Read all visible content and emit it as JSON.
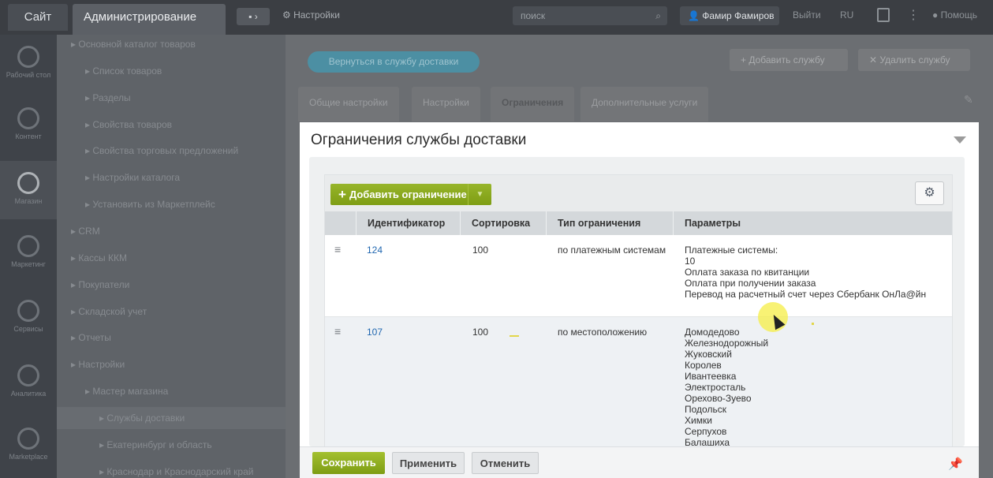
{
  "topbar": {
    "site_tab": "Сайт",
    "admin_tab": "Администрирование",
    "chat_label": "▪ ›",
    "settings_label": "Настройки",
    "search_placeholder": "поиск",
    "user_name": "Фамир Фамиров",
    "exit_label": "Выйти",
    "lang_label": "RU",
    "help_label": "Помощь"
  },
  "iconbar": {
    "items": [
      {
        "label": "Рабочий стол",
        "icon": "desktop-icon"
      },
      {
        "label": "Контент",
        "icon": "content-icon"
      },
      {
        "label": "Магазин",
        "icon": "basket-icon"
      },
      {
        "label": "Маркетинг",
        "icon": "marketing-icon"
      },
      {
        "label": "Сервисы",
        "icon": "services-icon"
      },
      {
        "label": "Аналитика",
        "icon": "analytics-icon"
      },
      {
        "label": "Marketplace",
        "icon": "cloud-icon"
      }
    ]
  },
  "tree": {
    "items": [
      {
        "label": "▸  Основной каталог товаров"
      },
      {
        "label": "▸  Список товаров"
      },
      {
        "label": "▸  Разделы"
      },
      {
        "label": "▸  Свойства товаров"
      },
      {
        "label": "▸  Свойства торговых предложений"
      },
      {
        "label": "▸  Настройки каталога"
      },
      {
        "label": "▸  Установить из Маркетплейс"
      },
      {
        "label": "▸  CRM"
      },
      {
        "label": "▸  Кассы ККМ"
      },
      {
        "label": "▸  Покупатели"
      },
      {
        "label": "▸  Складской учет"
      },
      {
        "label": "▸  Отчеты"
      },
      {
        "label": "▸  Настройки"
      },
      {
        "label": "▸  Мастер магазина"
      },
      {
        "label": "▸  Службы доставки"
      },
      {
        "label": "▸  Екатеринбург и область"
      },
      {
        "label": "▸  Краснодар и Краснодарский край"
      }
    ]
  },
  "header": {
    "back_button": "Вернуться в службу доставки",
    "add_service": "Добавить службу",
    "delete_service": "Удалить службу"
  },
  "tabs": [
    {
      "label": "Общие настройки"
    },
    {
      "label": "Настройки"
    },
    {
      "label": "Ограничения"
    },
    {
      "label": "Дополнительные услуги"
    }
  ],
  "panel": {
    "title": "Ограничения службы доставки",
    "add_button": "Добавить ограничение",
    "columns": [
      "Идентификатор",
      "Сортировка",
      "Тип ограничения",
      "Параметры"
    ],
    "rows": [
      {
        "id": "124",
        "sort": "100",
        "type": "по платежным системам",
        "params": [
          "Платежные системы:",
          "10",
          "Оплата заказа по квитанции",
          "Оплата при получении заказа",
          "Перевод на расчетный счет через Сбербанк ОнЛа@йн"
        ]
      },
      {
        "id": "107",
        "sort": "100",
        "type": "по местоположению",
        "params": [
          "Домодедово",
          "Железнодорожный",
          "Жуковский",
          "Королев",
          "Ивантеевка",
          "Электросталь",
          "Орехово-Зуево",
          "Подольск",
          "Химки",
          "Серпухов",
          "Балашиха"
        ]
      }
    ]
  },
  "footer": {
    "save": "Сохранить",
    "apply": "Применить",
    "cancel": "Отменить"
  }
}
